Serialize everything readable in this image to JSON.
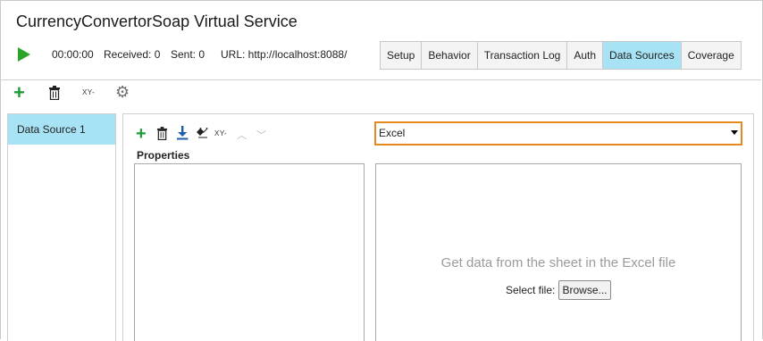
{
  "window": {
    "title": "CurrencyConvertorSoap Virtual Service"
  },
  "status": {
    "elapsed": "00:00:00",
    "received": "Received: 0",
    "sent": "Sent: 0",
    "url": "URL: http://localhost:8088/"
  },
  "tabs": [
    {
      "label": "Setup",
      "active": false
    },
    {
      "label": "Behavior",
      "active": false
    },
    {
      "label": "Transaction Log",
      "active": false
    },
    {
      "label": "Auth",
      "active": false
    },
    {
      "label": "Data Sources",
      "active": true
    },
    {
      "label": "Coverage",
      "active": false
    }
  ],
  "toolbar": {
    "add_icon": "plus-icon",
    "delete_icon": "trash-icon",
    "rename_label": "XY-",
    "settings_icon": "gear-icon"
  },
  "datasources": {
    "items": [
      {
        "label": "Data Source 1",
        "selected": true
      }
    ]
  },
  "editor": {
    "toolbar": {
      "add_icon": "plus-icon",
      "delete_icon": "trash-icon",
      "download_icon": "download-icon",
      "erase_icon": "eraser-icon",
      "rename_label": "XY-",
      "up_icon": "chevron-up-icon",
      "down_icon": "chevron-down-icon"
    },
    "type_select": {
      "value": "Excel"
    },
    "properties_label": "Properties",
    "info_text": "Get data from the sheet in the Excel file",
    "select_file_label": "Select file:",
    "browse_label": "Browse..."
  },
  "colors": {
    "accent": "#a7e3f5",
    "play_green": "#2aa52a",
    "add_green": "#1f9c3a",
    "focus_orange": "#e58a1f",
    "info_grey": "#9a9a9a"
  }
}
